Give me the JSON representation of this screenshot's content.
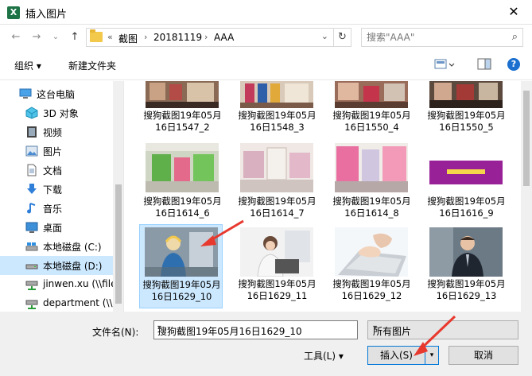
{
  "window": {
    "title": "插入图片",
    "close_glyph": "✕"
  },
  "nav": {
    "back_glyph": "←",
    "forward_glyph": "→",
    "history_glyph": "⌄",
    "up_glyph": "↑",
    "overflow": "«",
    "breadcrumb": [
      "截图",
      "20181119",
      "AAA"
    ],
    "search_placeholder": "搜索\"AAA\""
  },
  "toolbar": {
    "organize": "组织 ▾",
    "new_folder": "新建文件夹"
  },
  "sidebar": {
    "items": [
      {
        "label": "这台电脑",
        "icon": "computer-icon"
      },
      {
        "label": "3D 对象",
        "icon": "3d-objects-icon"
      },
      {
        "label": "视频",
        "icon": "video-icon"
      },
      {
        "label": "图片",
        "icon": "pictures-icon"
      },
      {
        "label": "文档",
        "icon": "documents-icon"
      },
      {
        "label": "下载",
        "icon": "download-icon"
      },
      {
        "label": "音乐",
        "icon": "music-icon"
      },
      {
        "label": "桌面",
        "icon": "desktop-icon"
      },
      {
        "label": "本地磁盘 (C:)",
        "icon": "drive-icon"
      },
      {
        "label": "本地磁盘 (D:)",
        "icon": "drive-icon"
      },
      {
        "label": "jinwen.xu (\\\\file",
        "icon": "network-drive-icon"
      },
      {
        "label": "department (\\\\",
        "icon": "network-drive-icon"
      }
    ],
    "selected_index": 9
  },
  "files": [
    {
      "name": "搜狗截图19年05月16日1547_2"
    },
    {
      "name": "搜狗截图19年05月16日1548_3"
    },
    {
      "name": "搜狗截图19年05月16日1550_4"
    },
    {
      "name": "搜狗截图19年05月16日1550_5"
    },
    {
      "name": "搜狗截图19年05月16日1614_6"
    },
    {
      "name": "搜狗截图19年05月16日1614_7"
    },
    {
      "name": "搜狗截图19年05月16日1614_8"
    },
    {
      "name": "搜狗截图19年05月16日1616_9"
    },
    {
      "name": "搜狗截图19年05月16日1629_10"
    },
    {
      "name": "搜狗截图19年05月16日1629_11"
    },
    {
      "name": "搜狗截图19年05月16日1629_12"
    },
    {
      "name": "搜狗截图19年05月16日1629_13"
    }
  ],
  "selected_file_index": 8,
  "footer": {
    "filename_label": "文件名(N):",
    "filename_value": "搜狗截图19年05月16日1629_10",
    "filter_value": "所有图片",
    "tools_label": "工具(L)",
    "insert_label": "插入(S)",
    "cancel_label": "取消",
    "dropdown_glyph": "▾"
  },
  "colors": {
    "accent": "#0078d7",
    "selection": "#cce8ff",
    "annotation": "#e8392f"
  }
}
